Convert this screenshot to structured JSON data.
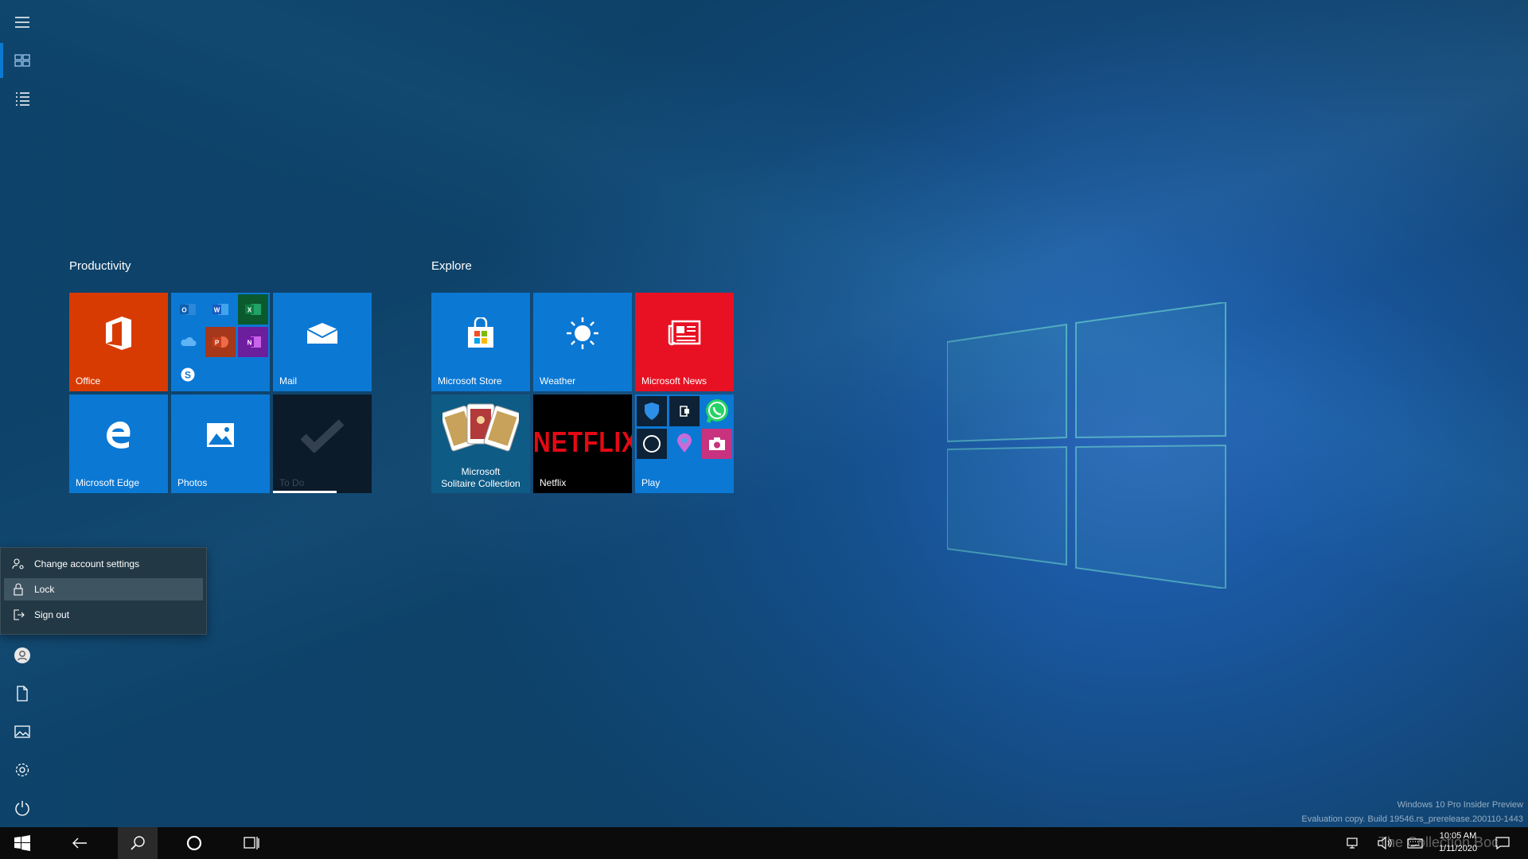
{
  "start": {
    "groups": [
      {
        "title": "Productivity"
      },
      {
        "title": "Explore"
      }
    ],
    "tiles": {
      "office": "Office",
      "mail": "Mail",
      "edge": "Microsoft Edge",
      "photos": "Photos",
      "todo": "To Do",
      "store": "Microsoft Store",
      "weather": "Weather",
      "news": "Microsoft News",
      "solitaire_line1": "Microsoft",
      "solitaire_line2": "Solitaire Collection",
      "netflix": "Netflix",
      "netflix_logo": "NETFLIX",
      "play": "Play"
    },
    "mini_apps": {
      "outlook": "O",
      "word": "W",
      "excel": "X",
      "powerpoint": "P",
      "onenote": "N",
      "skype": "S"
    }
  },
  "account_menu": {
    "items": [
      {
        "label": "Change account settings",
        "icon": "person-gear-icon"
      },
      {
        "label": "Lock",
        "icon": "lock-icon"
      },
      {
        "label": "Sign out",
        "icon": "sign-out-icon"
      }
    ]
  },
  "watermark": {
    "line1": "Windows 10 Pro Insider Preview",
    "line2": "Evaluation copy. Build 19546.rs_prerelease.200110-1443"
  },
  "tray": {
    "time": "10:05 AM",
    "date": "1/11/2020",
    "overlay_text": "The Collection Book"
  },
  "colors": {
    "accent": "#0b79d0",
    "tile_blue": "#0b78d4",
    "office_orange": "#d83b01",
    "news_red": "#e81123",
    "todo_dark": "#0c1b2a"
  }
}
